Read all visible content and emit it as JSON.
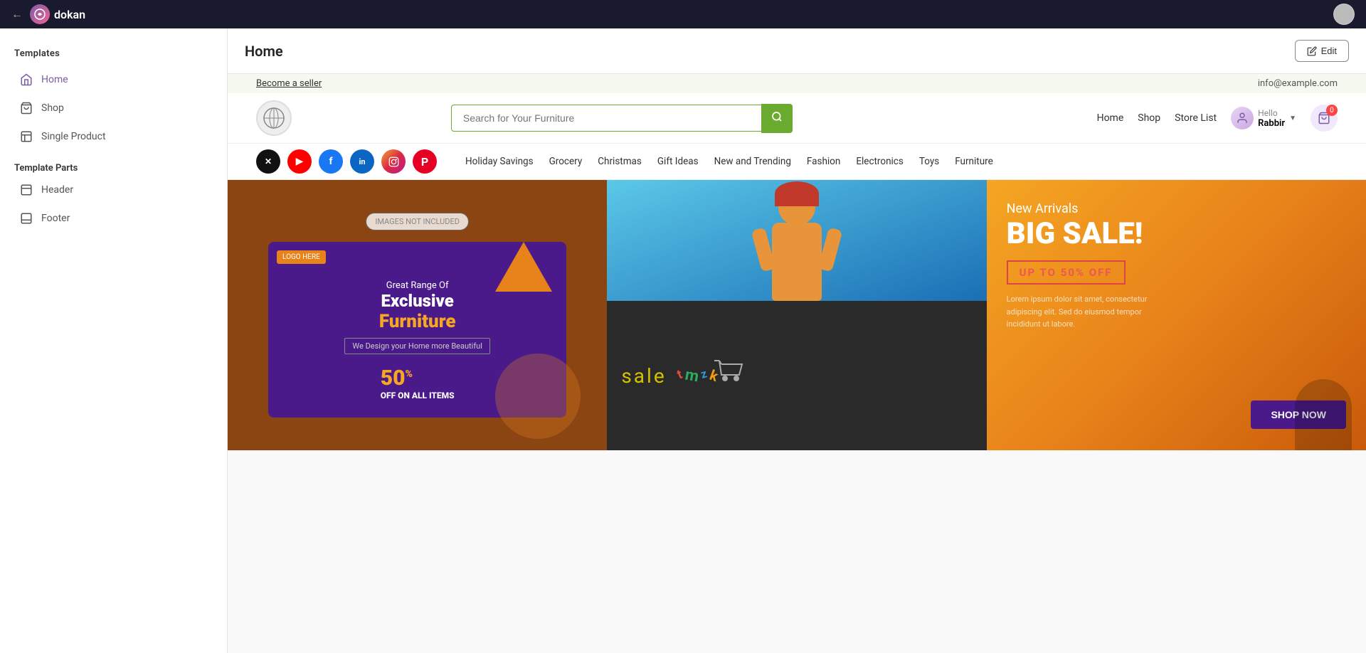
{
  "app": {
    "name": "dokan",
    "logo_text": "dokan"
  },
  "top_bar": {
    "back_icon": "←"
  },
  "sidebar": {
    "section1_title": "Templates",
    "items": [
      {
        "id": "home",
        "label": "Home",
        "active": true
      },
      {
        "id": "shop",
        "label": "Shop",
        "active": false
      },
      {
        "id": "single-product",
        "label": "Single Product",
        "active": false
      }
    ],
    "section2_title": "Template Parts",
    "part_items": [
      {
        "id": "header",
        "label": "Header"
      },
      {
        "id": "footer",
        "label": "Footer"
      }
    ]
  },
  "page_header": {
    "title": "Home",
    "edit_label": "Edit"
  },
  "store_topbar": {
    "become_seller": "Become a seller",
    "email": "info@example.com"
  },
  "store_navbar": {
    "search_placeholder": "Search for Your Furniture",
    "search_icon": "🔍",
    "nav_links": [
      "Home",
      "Shop",
      "Store List"
    ],
    "user_greeting": "Hello",
    "user_name": "Rabbir",
    "cart_count": "0"
  },
  "categories": {
    "social_icons": [
      {
        "id": "x",
        "label": "X",
        "class": "social-x"
      },
      {
        "id": "youtube",
        "label": "▶",
        "class": "social-yt"
      },
      {
        "id": "facebook",
        "label": "f",
        "class": "social-fb"
      },
      {
        "id": "linkedin",
        "label": "in",
        "class": "social-li"
      },
      {
        "id": "instagram",
        "label": "📷",
        "class": "social-ig"
      },
      {
        "id": "pinterest",
        "label": "P",
        "class": "social-pt"
      }
    ],
    "links": [
      "Holiday Savings",
      "Grocery",
      "Christmas",
      "Gift Ideas",
      "New and Trending",
      "Fashion",
      "Electronics",
      "Toys",
      "Furniture"
    ]
  },
  "banners": {
    "banner1": {
      "images_not_included": "IMAGES NOT INCLUDED",
      "logo_placeholder": "LOGO HERE",
      "subtitle1": "Great Range Of",
      "title1": "Exclusive",
      "title2": "Furniture",
      "tagline": "We Design your Home more Beautiful",
      "discount_prefix": "50%",
      "discount_suffix": "OFF ON ALL ITEMS"
    },
    "banner2a": {
      "alt": "Shopping girl with bags"
    },
    "banner2b": {
      "sale_text": "sale",
      "alt": "Colorful sale toys"
    },
    "banner3": {
      "subtitle": "New Arrivals",
      "title": "BIG SALE!",
      "offer": "UP TO 50% OFF",
      "description": "Lorem ipsum dolor sit amet, consectetur adipiscing elit. Sed do eiusmod tempor incididunt ut labore.",
      "cta": "SHOP NOW"
    }
  }
}
